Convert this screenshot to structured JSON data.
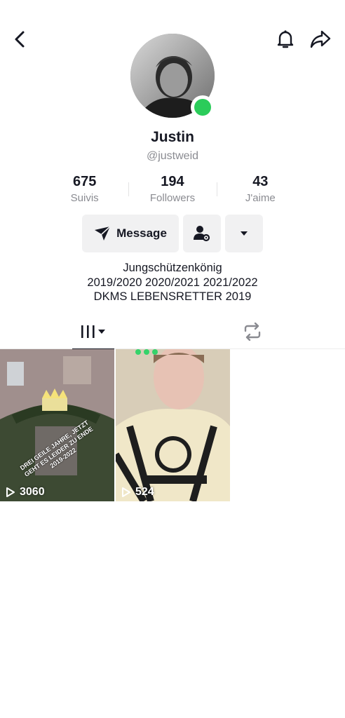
{
  "header": {
    "back_icon": "chevron-left-icon",
    "bell_icon": "bell-icon",
    "share_icon": "share-arrow-icon"
  },
  "profile": {
    "name": "Justin",
    "handle": "@justweid",
    "online": true,
    "online_color": "#2bcc5a"
  },
  "stats": [
    {
      "value": "675",
      "label": "Suivis"
    },
    {
      "value": "194",
      "label": "Followers"
    },
    {
      "value": "43",
      "label": "J'aime"
    }
  ],
  "actions": {
    "message_label": "Message",
    "message_icon": "send-icon",
    "add_user_icon": "user-settings-icon",
    "more_icon": "caret-down-icon"
  },
  "bio": {
    "line1": "Jungschützenkönig",
    "line2": "2019/2020 2020/2021 2021/2022",
    "line3": "DKMS LEBENSRETTER 2019"
  },
  "tabs": {
    "videos_icon": "grid-lines-icon",
    "reposts_icon": "repost-icon"
  },
  "videos": [
    {
      "views": "3060",
      "caption": "DREI GEILE JAHRE, JETZT GEHT ES LEIDER ZU ENDE 2019-2022"
    },
    {
      "views": "524"
    }
  ]
}
